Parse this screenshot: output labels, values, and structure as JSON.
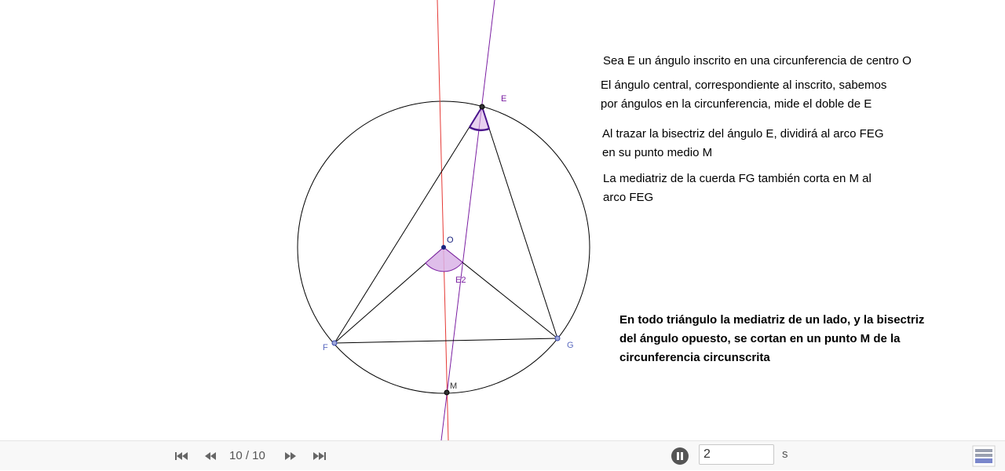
{
  "text": {
    "line1": "Sea E un ángulo inscrito en una circunferencia de centro O",
    "line2": "El ángulo central, correspondiente al inscrito, sabemos\npor ángulos en la circunferencia, mide el doble de E",
    "line3": "Al trazar la bisectriz del ángulo E, dividirá al arco FEG\nen su punto medio M",
    "line4": "La mediatriz de la cuerda FG también corta en M al\narco FEG",
    "conclusion": "En todo triángulo la mediatriz de un lado, y la bisectriz\ndel ángulo opuesto, se cortan en un punto M de la\ncircunferencia circunscrita"
  },
  "points": {
    "E": "E",
    "O": "O",
    "E2": "E2",
    "F": "F",
    "G": "G",
    "M": "M"
  },
  "colors": {
    "bisector": "#7b1fa2",
    "perp_bisector": "#e53935",
    "angle_fill": "#d9b3e6",
    "free_point": "#5c6bc0",
    "center_point": "#1a237e"
  },
  "toolbar": {
    "step_counter": "10 / 10",
    "speed_value": "2",
    "speed_unit": "s",
    "first_icon": "skip-first-icon",
    "prev_icon": "rewind-icon",
    "next_icon": "fast-forward-icon",
    "last_icon": "skip-last-icon",
    "pause_icon": "pause-icon",
    "algebra_icon": "algebra-view-icon"
  }
}
